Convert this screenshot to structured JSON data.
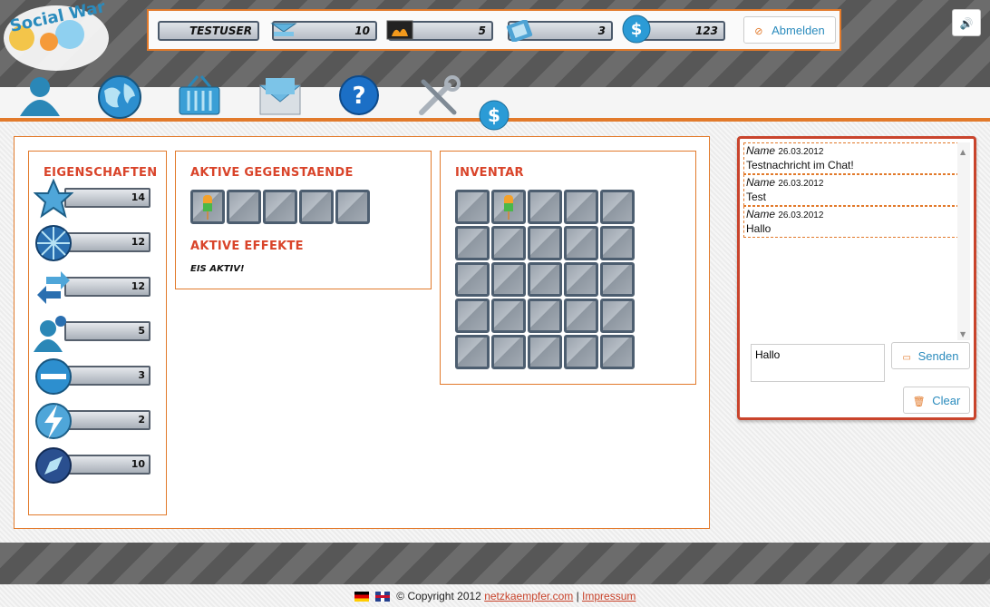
{
  "header": {
    "logo_text": "Social War",
    "stats": {
      "username": "TESTUSER",
      "stat_a": "10",
      "stat_b": "5",
      "stat_c": "3",
      "money": "123"
    },
    "logout_label": "Abmelden",
    "sound_icon": "speaker-icon"
  },
  "nav": {
    "items": [
      {
        "icon": "user-icon"
      },
      {
        "icon": "globe-icon"
      },
      {
        "icon": "basket-icon"
      },
      {
        "icon": "mail-icon"
      },
      {
        "icon": "help-icon"
      },
      {
        "icon": "tools-icon"
      },
      {
        "icon": "dollar-icon"
      }
    ]
  },
  "properties": {
    "title": "EIGENSCHAFTEN",
    "items": [
      {
        "icon": "star-icon",
        "value": "14"
      },
      {
        "icon": "snowflake-icon",
        "value": "12"
      },
      {
        "icon": "arrows-icon",
        "value": "12"
      },
      {
        "icon": "users-icon",
        "value": "5"
      },
      {
        "icon": "shield-icon",
        "value": "3"
      },
      {
        "icon": "lightning-icon",
        "value": "2"
      },
      {
        "icon": "compass-icon",
        "value": "10"
      }
    ]
  },
  "active_items": {
    "title": "AKTIVE GEGENSTAENDE",
    "effects_title": "AKTIVE EFFEKTE",
    "effect_text": "EIS AKTIV!"
  },
  "inventory": {
    "title": "INVENTAR"
  },
  "chat": {
    "messages": [
      {
        "name": "Name",
        "date": "26.03.2012",
        "text": "Testnachricht im Chat!"
      },
      {
        "name": "Name",
        "date": "26.03.2012",
        "text": "Test"
      },
      {
        "name": "Name",
        "date": "26.03.2012",
        "text": "Hallo"
      }
    ],
    "input_value": "Hallo",
    "send_label": "Senden",
    "clear_label": "Clear"
  },
  "footer": {
    "copyright": "© Copyright 2012",
    "link1": "netzkaempfer.com",
    "separator": "|",
    "link2": "Impressum"
  },
  "colors": {
    "accent": "#e27a2b",
    "title_red": "#d9442a",
    "link_blue": "#2a8bbd"
  }
}
